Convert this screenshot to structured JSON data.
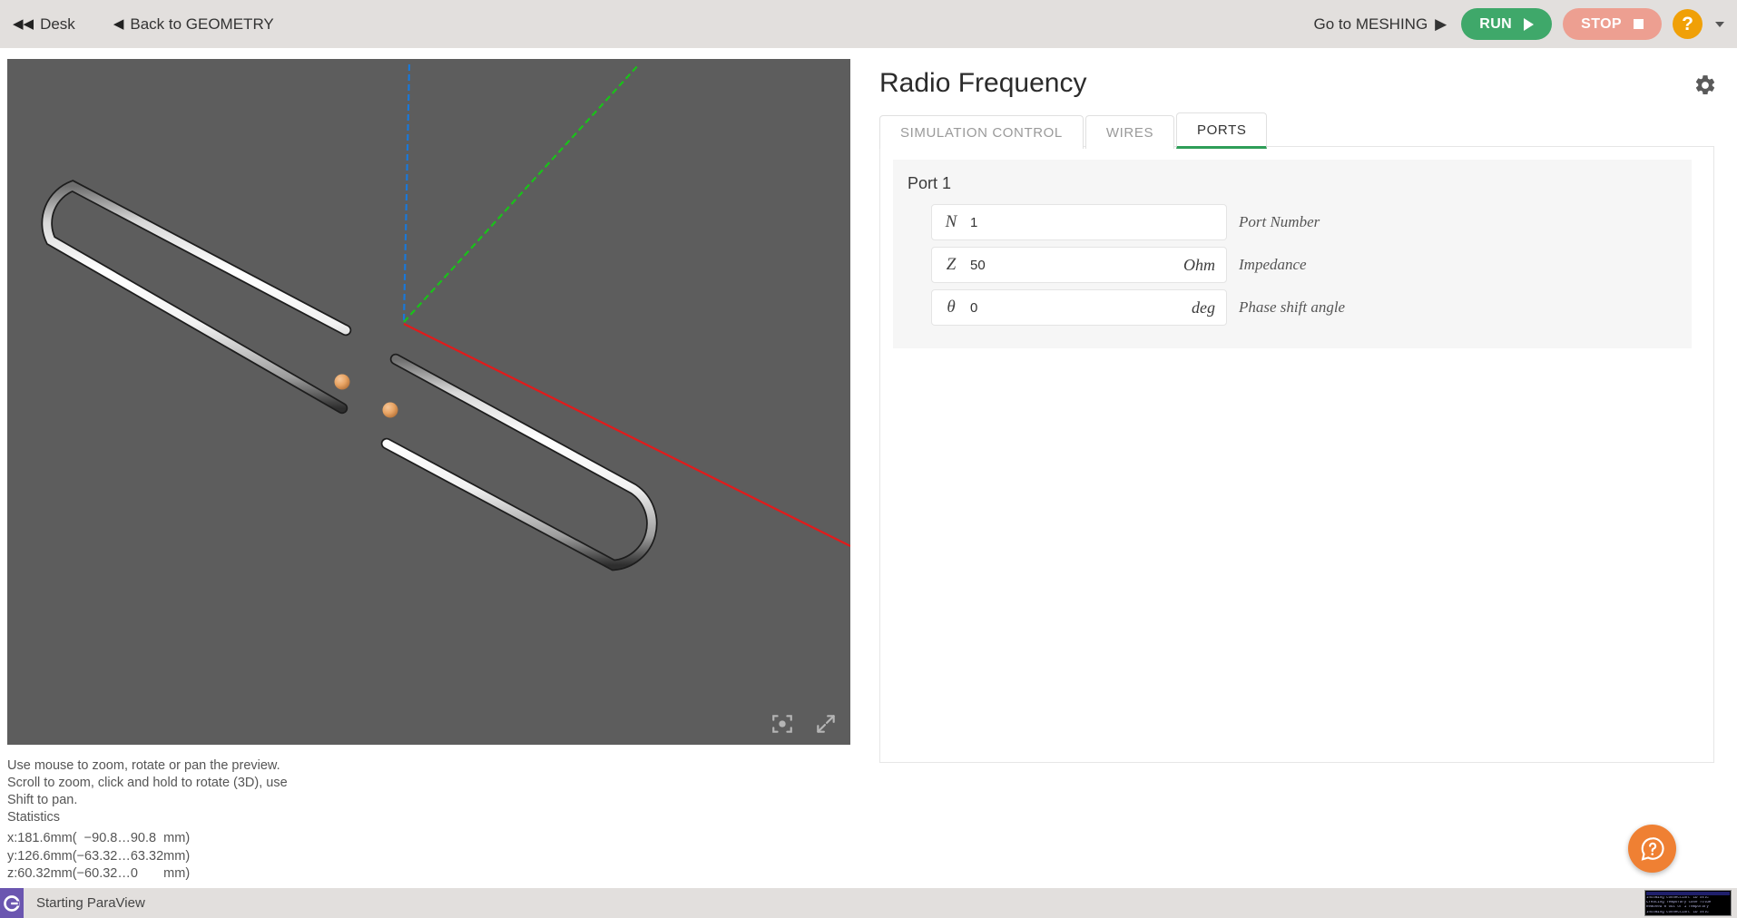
{
  "topbar": {
    "desk_label": "Desk",
    "desk_icon": "double-left-arrow-icon",
    "back_label": "Back to GEOMETRY",
    "back_icon": "left-arrow-icon",
    "goto_label": "Go to MESHING",
    "goto_icon": "right-arrow-icon",
    "run_label": "RUN",
    "stop_label": "STOP",
    "help_label": "?",
    "colors": {
      "bar_bg": "#e2dfdd",
      "run_bg": "#3fa86a",
      "stop_bg": "#ed9f91",
      "help_bg": "#f0a007"
    }
  },
  "viewport": {
    "background": "#5d5d5d",
    "axes": {
      "x_color": "#e21b1b",
      "y_color": "#19c219",
      "z_color": "#1a78d8"
    },
    "wire_color": "#f0f0f0",
    "port_marker_color": "#e8a464",
    "tools": {
      "center_icon": "center-focus-icon",
      "expand_icon": "expand-arrows-icon"
    }
  },
  "hints": {
    "line1": "Use mouse to zoom, rotate or pan the preview.",
    "line2": "Scroll to zoom, click and hold to rotate (3D), use",
    "line3": "Shift to pan."
  },
  "statistics": {
    "title": "Statistics",
    "rows": [
      {
        "axis": "x:",
        "size": "181.6",
        "unit": "mm",
        "open": "(",
        "min": "−90.8",
        "dots": "…",
        "max": "90.8",
        "unit2": "mm)"
      },
      {
        "axis": "y:",
        "size": "126.6",
        "unit": "mm",
        "open": "(",
        "min": "−63.32",
        "dots": "…",
        "max": "63.32",
        "unit2": "mm)"
      },
      {
        "axis": "z:",
        "size": "60.32",
        "unit": "mm",
        "open": "(",
        "min": "−60.32",
        "dots": "…",
        "max": "0",
        "unit2": "mm)"
      }
    ]
  },
  "panel": {
    "title": "Radio Frequency",
    "settings_icon": "gear-icon",
    "tabs": [
      {
        "label": "SIMULATION CONTROL",
        "active": false
      },
      {
        "label": "WIRES",
        "active": false
      },
      {
        "label": "PORTS",
        "active": true
      }
    ],
    "active_tab_accent": "#2e9e58",
    "port": {
      "card_title": "Port 1",
      "fields": [
        {
          "symbol": "N",
          "value": "1",
          "unit": "",
          "label": "Port Number"
        },
        {
          "symbol": "Z",
          "value": "50",
          "unit": "Ohm",
          "label": "Impedance"
        },
        {
          "symbol": "θ",
          "value": "0",
          "unit": "deg",
          "label": "Phase shift angle"
        }
      ]
    }
  },
  "fab": {
    "icon": "help-bubble-icon",
    "color": "#ef8033"
  },
  "statusbar": {
    "logo_icon": "paraview-logo-icon",
    "logo_color": "#6b56b0",
    "text": "Starting ParaView",
    "console": {
      "lines": [
        "Incoming connection. ID xxlc",
        "Creating Temporary case folde",
        "Removed 0 out of 1 Temporary",
        "Incoming connection. ID xxlc"
      ]
    }
  }
}
